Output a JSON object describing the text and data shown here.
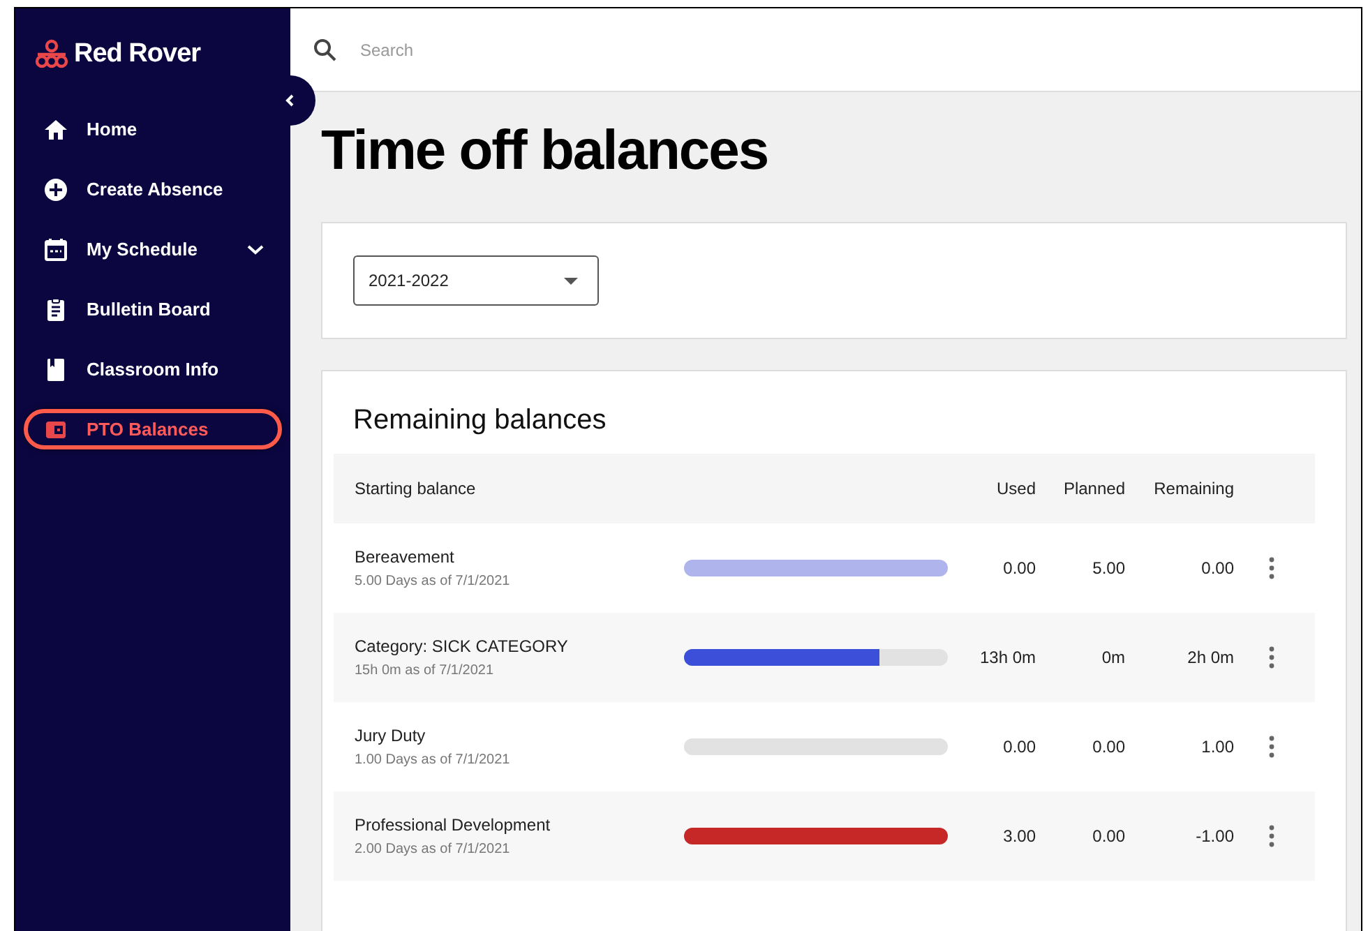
{
  "sidebar": {
    "brand": "Red Rover",
    "items": [
      {
        "label": "Home",
        "selected": false
      },
      {
        "label": "Create Absence",
        "selected": false
      },
      {
        "label": "My Schedule",
        "selected": false,
        "expandable": true
      },
      {
        "label": "Bulletin Board",
        "selected": false
      },
      {
        "label": "Classroom Info",
        "selected": false
      },
      {
        "label": "PTO Balances",
        "selected": true
      }
    ]
  },
  "search": {
    "placeholder": "Search"
  },
  "page_title": "Time off balances",
  "year_select": {
    "value": "2021-2022"
  },
  "balances": {
    "title": "Remaining balances",
    "columns": [
      "Starting balance",
      "Used",
      "Planned",
      "Remaining"
    ],
    "rows": [
      {
        "name": "Bereavement",
        "starting": "5.00 Days as of 7/1/2021",
        "level": 1,
        "color": "#afb4ec",
        "used": "0.00",
        "planned": "5.00",
        "remaining": "0.00"
      },
      {
        "name": "Category: SICK CATEGORY",
        "starting": "15h 0m as of 7/1/2021",
        "level": 0.74,
        "color": "#3b4fd8",
        "used": "13h 0m",
        "planned": "0m",
        "remaining": "2h 0m"
      },
      {
        "name": "Jury Duty",
        "starting": "1.00 Days as of 7/1/2021",
        "level": 0,
        "used": "0.00",
        "planned": "0.00",
        "remaining": "1.00"
      },
      {
        "name": "Professional Development",
        "starting": "2.00 Days as of 7/1/2021",
        "level": 1,
        "color": "#c62828",
        "used": "3.00",
        "planned": "0.00",
        "remaining": "-1.00"
      }
    ]
  }
}
